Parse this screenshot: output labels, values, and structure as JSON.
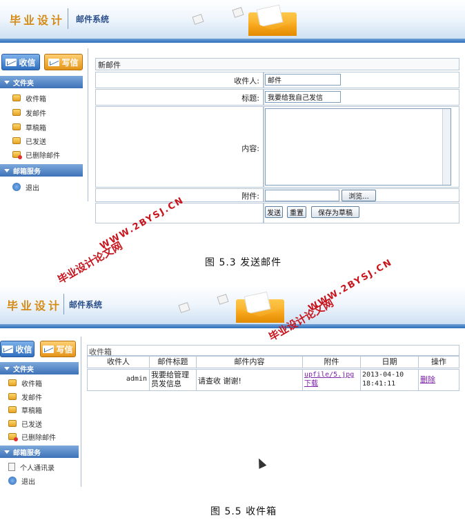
{
  "banner": {
    "brand": "毕业设计",
    "system": "邮件系统"
  },
  "sidebar": {
    "receive_label": "收信",
    "write_label": "写信",
    "folders_title": "文件夹",
    "folders": [
      "收件箱",
      "发邮件",
      "草稿箱",
      "已发送",
      "已删除邮件"
    ],
    "service_title": "邮箱服务",
    "service_items_top": [
      "退出"
    ],
    "service_items_bottom": [
      "个人通讯录",
      "退出"
    ]
  },
  "compose": {
    "title": "新邮件",
    "to_label": "收件人:",
    "to_value": "邮件",
    "subject_label": "标题:",
    "subject_value": "我要给我自己发信",
    "content_label": "内容:",
    "attach_label": "附件:",
    "browse_label": "浏览...",
    "send_label": "发送",
    "reset_label": "重置",
    "draft_label": "保存为草稿"
  },
  "caption_top": "图 5.3  发送邮件",
  "caption_bottom": "图 5.5  收件箱",
  "watermark": {
    "title": "毕业设计论文网",
    "url": "WWW.2BYSJ.CN"
  },
  "inbox": {
    "title": "收件箱",
    "columns": [
      "收件人",
      "邮件标题",
      "邮件内容",
      "附件",
      "日期",
      "操作"
    ],
    "rows": [
      {
        "recipient": "admin",
        "subject": "我要给管理员发信息",
        "content": "请查收 谢谢!",
        "attachment": "upfile/5.jpg下载",
        "date": "2013-04-10 18:41:11",
        "action": "删除"
      }
    ]
  },
  "colors": {
    "accent": "#2f6fc0",
    "brand": "#d68a14",
    "watermark": "#c8141c",
    "link": "#7a1fa8"
  }
}
